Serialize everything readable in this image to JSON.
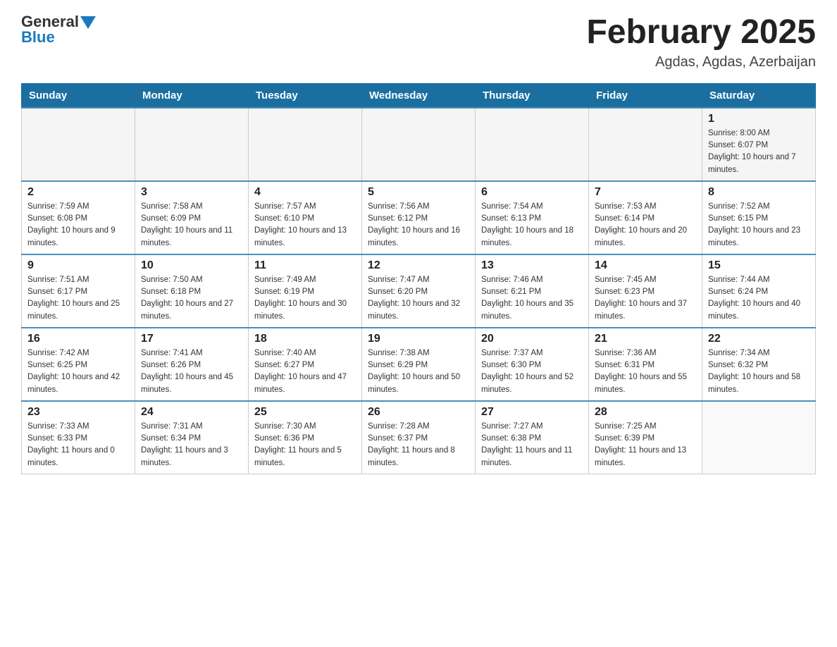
{
  "header": {
    "logo_general": "General",
    "logo_blue": "Blue",
    "month_title": "February 2025",
    "location": "Agdas, Agdas, Azerbaijan"
  },
  "days_of_week": [
    "Sunday",
    "Monday",
    "Tuesday",
    "Wednesday",
    "Thursday",
    "Friday",
    "Saturday"
  ],
  "weeks": [
    [
      {
        "day": "",
        "info": ""
      },
      {
        "day": "",
        "info": ""
      },
      {
        "day": "",
        "info": ""
      },
      {
        "day": "",
        "info": ""
      },
      {
        "day": "",
        "info": ""
      },
      {
        "day": "",
        "info": ""
      },
      {
        "day": "1",
        "info": "Sunrise: 8:00 AM\nSunset: 6:07 PM\nDaylight: 10 hours and 7 minutes."
      }
    ],
    [
      {
        "day": "2",
        "info": "Sunrise: 7:59 AM\nSunset: 6:08 PM\nDaylight: 10 hours and 9 minutes."
      },
      {
        "day": "3",
        "info": "Sunrise: 7:58 AM\nSunset: 6:09 PM\nDaylight: 10 hours and 11 minutes."
      },
      {
        "day": "4",
        "info": "Sunrise: 7:57 AM\nSunset: 6:10 PM\nDaylight: 10 hours and 13 minutes."
      },
      {
        "day": "5",
        "info": "Sunrise: 7:56 AM\nSunset: 6:12 PM\nDaylight: 10 hours and 16 minutes."
      },
      {
        "day": "6",
        "info": "Sunrise: 7:54 AM\nSunset: 6:13 PM\nDaylight: 10 hours and 18 minutes."
      },
      {
        "day": "7",
        "info": "Sunrise: 7:53 AM\nSunset: 6:14 PM\nDaylight: 10 hours and 20 minutes."
      },
      {
        "day": "8",
        "info": "Sunrise: 7:52 AM\nSunset: 6:15 PM\nDaylight: 10 hours and 23 minutes."
      }
    ],
    [
      {
        "day": "9",
        "info": "Sunrise: 7:51 AM\nSunset: 6:17 PM\nDaylight: 10 hours and 25 minutes."
      },
      {
        "day": "10",
        "info": "Sunrise: 7:50 AM\nSunset: 6:18 PM\nDaylight: 10 hours and 27 minutes."
      },
      {
        "day": "11",
        "info": "Sunrise: 7:49 AM\nSunset: 6:19 PM\nDaylight: 10 hours and 30 minutes."
      },
      {
        "day": "12",
        "info": "Sunrise: 7:47 AM\nSunset: 6:20 PM\nDaylight: 10 hours and 32 minutes."
      },
      {
        "day": "13",
        "info": "Sunrise: 7:46 AM\nSunset: 6:21 PM\nDaylight: 10 hours and 35 minutes."
      },
      {
        "day": "14",
        "info": "Sunrise: 7:45 AM\nSunset: 6:23 PM\nDaylight: 10 hours and 37 minutes."
      },
      {
        "day": "15",
        "info": "Sunrise: 7:44 AM\nSunset: 6:24 PM\nDaylight: 10 hours and 40 minutes."
      }
    ],
    [
      {
        "day": "16",
        "info": "Sunrise: 7:42 AM\nSunset: 6:25 PM\nDaylight: 10 hours and 42 minutes."
      },
      {
        "day": "17",
        "info": "Sunrise: 7:41 AM\nSunset: 6:26 PM\nDaylight: 10 hours and 45 minutes."
      },
      {
        "day": "18",
        "info": "Sunrise: 7:40 AM\nSunset: 6:27 PM\nDaylight: 10 hours and 47 minutes."
      },
      {
        "day": "19",
        "info": "Sunrise: 7:38 AM\nSunset: 6:29 PM\nDaylight: 10 hours and 50 minutes."
      },
      {
        "day": "20",
        "info": "Sunrise: 7:37 AM\nSunset: 6:30 PM\nDaylight: 10 hours and 52 minutes."
      },
      {
        "day": "21",
        "info": "Sunrise: 7:36 AM\nSunset: 6:31 PM\nDaylight: 10 hours and 55 minutes."
      },
      {
        "day": "22",
        "info": "Sunrise: 7:34 AM\nSunset: 6:32 PM\nDaylight: 10 hours and 58 minutes."
      }
    ],
    [
      {
        "day": "23",
        "info": "Sunrise: 7:33 AM\nSunset: 6:33 PM\nDaylight: 11 hours and 0 minutes."
      },
      {
        "day": "24",
        "info": "Sunrise: 7:31 AM\nSunset: 6:34 PM\nDaylight: 11 hours and 3 minutes."
      },
      {
        "day": "25",
        "info": "Sunrise: 7:30 AM\nSunset: 6:36 PM\nDaylight: 11 hours and 5 minutes."
      },
      {
        "day": "26",
        "info": "Sunrise: 7:28 AM\nSunset: 6:37 PM\nDaylight: 11 hours and 8 minutes."
      },
      {
        "day": "27",
        "info": "Sunrise: 7:27 AM\nSunset: 6:38 PM\nDaylight: 11 hours and 11 minutes."
      },
      {
        "day": "28",
        "info": "Sunrise: 7:25 AM\nSunset: 6:39 PM\nDaylight: 11 hours and 13 minutes."
      },
      {
        "day": "",
        "info": ""
      }
    ]
  ]
}
